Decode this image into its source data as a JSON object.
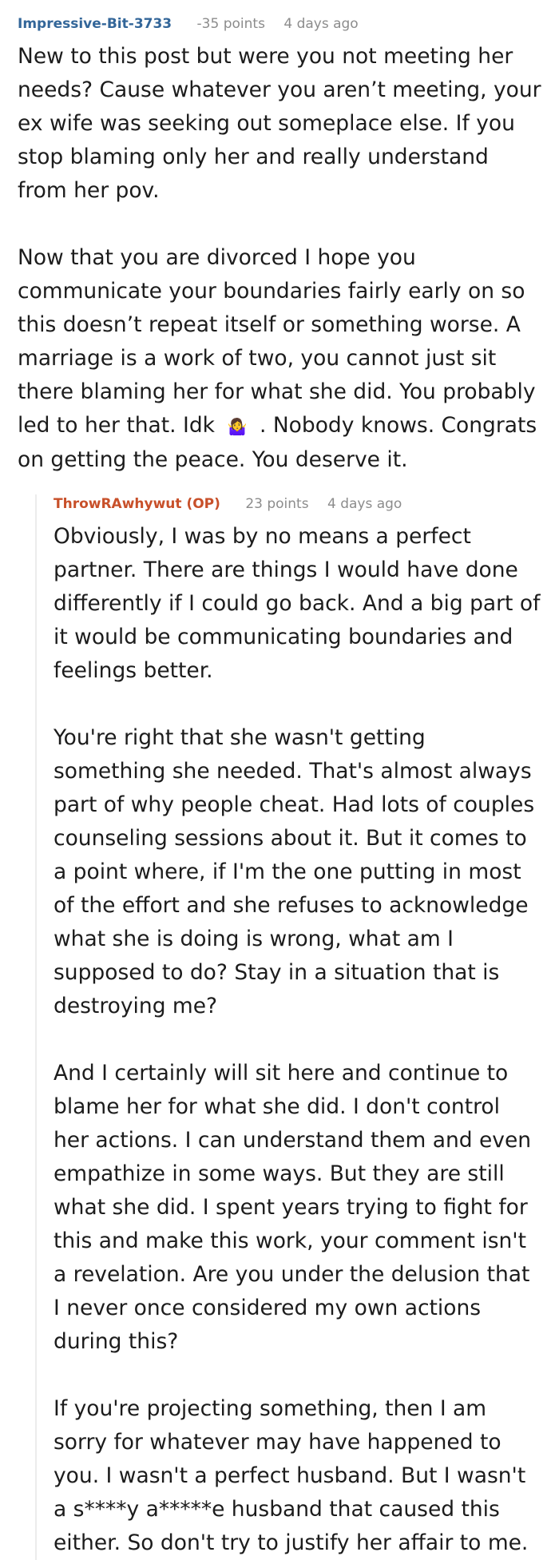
{
  "parent_comment": {
    "author": "Impressive-Bit-3733",
    "points": "-35 points",
    "time": "4 days ago",
    "paragraphs": [
      "New to this post but were you not meeting her needs? Cause whatever you aren’t meeting, your ex wife was seeking out someplace else. If you stop blaming only her and really understand from her pov.",
      "Now that you are divorced I hope you communicate your boundaries fairly early on so this doesn’t repeat itself or something worse. A marriage is a work of two, you cannot just sit there blaming her for what she did. You probably led to her that. Idk",
      ". Nobody knows. Congrats on getting the peace. You deserve it."
    ],
    "emoji": "🤷‍♀️"
  },
  "reply_comment": {
    "author": "ThrowRAwhywut (OP)",
    "points": "23 points",
    "time": "4 days ago",
    "paragraphs": [
      "Obviously, I was by no means a perfect partner. There are things I would have done differently if I could go back. And a big part of it would be communicating boundaries and feelings better.",
      "You're right that she wasn't getting something she needed. That's almost always part of why people cheat. Had lots of couples counseling sessions about it. But it comes to a point where, if I'm the one putting in most of the effort and she refuses to acknowledge what she is doing is wrong, what am I supposed to do? Stay in a situation that is destroying me?",
      "And I certainly will sit here and continue to blame her for what she did. I don't control her actions. I can understand them and even empathize in some ways. But they are still what she did. I spent years trying to fight for this and make this work, your comment isn't a revelation. Are you under the delusion that I never once considered my own actions during this?",
      "If you're projecting something, then I am sorry for whatever may have happened to you. I wasn't a perfect husband. But I wasn't a s****y a*****e husband that caused this either. So don't try to justify her affair to me."
    ]
  }
}
